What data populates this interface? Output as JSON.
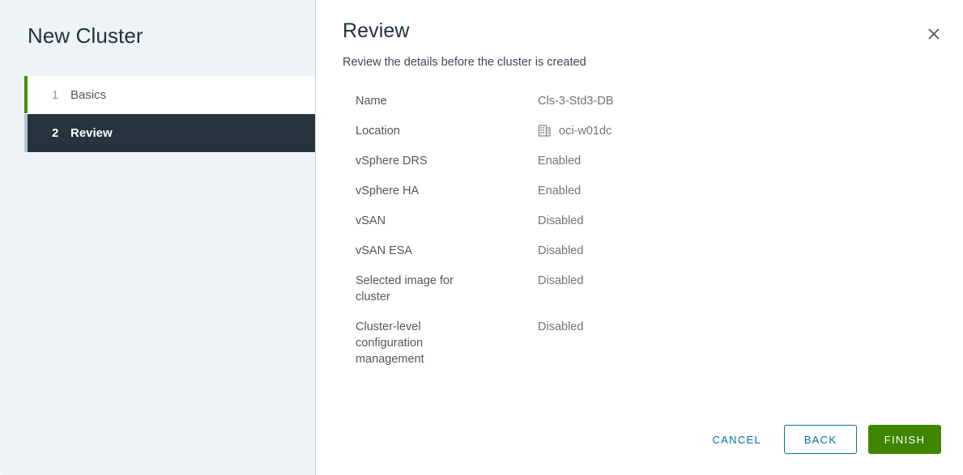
{
  "wizard": {
    "title": "New Cluster",
    "steps": [
      {
        "number": "1",
        "label": "Basics",
        "state": "completed"
      },
      {
        "number": "2",
        "label": "Review",
        "state": "active"
      }
    ]
  },
  "main": {
    "title": "Review",
    "subtitle": "Review the details before the cluster is created",
    "close_icon": "close-icon",
    "details": [
      {
        "label": "Name",
        "value": "Cls-3-Std3-DB",
        "icon": null
      },
      {
        "label": "Location",
        "value": "oci-w01dc",
        "icon": "datacenter-icon"
      },
      {
        "label": "vSphere DRS",
        "value": "Enabled",
        "icon": null
      },
      {
        "label": "vSphere HA",
        "value": "Enabled",
        "icon": null
      },
      {
        "label": "vSAN",
        "value": "Disabled",
        "icon": null
      },
      {
        "label": "vSAN ESA",
        "value": "Disabled",
        "icon": null
      },
      {
        "label": "Selected image for\ncluster",
        "value": "Disabled",
        "icon": null
      },
      {
        "label": "Cluster-level\nconfiguration\nmanagement",
        "value": "Disabled",
        "icon": null
      }
    ]
  },
  "footer": {
    "cancel_label": "CANCEL",
    "back_label": "BACK",
    "finish_label": "FINISH"
  },
  "colors": {
    "accent_green": "#3f8600",
    "step_completed_bar": "#468c00",
    "step_pending_bar": "#b7c4cb",
    "step_active_bg": "#27333d",
    "link_blue": "#0072a3",
    "sidebar_bg": "#eef3f6"
  }
}
